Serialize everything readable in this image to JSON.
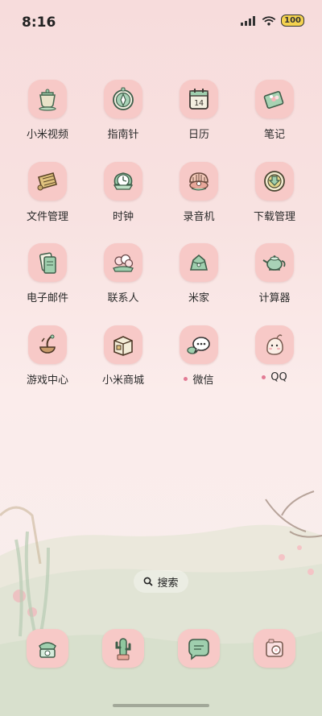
{
  "status": {
    "time": "8:16",
    "battery": "100"
  },
  "apps": [
    {
      "label": "小米视频",
      "icon": "tea-cup-icon"
    },
    {
      "label": "指南针",
      "icon": "compass-icon"
    },
    {
      "label": "日历",
      "icon": "calendar-icon",
      "day": "14"
    },
    {
      "label": "笔记",
      "icon": "notes-icon"
    },
    {
      "label": "文件管理",
      "icon": "scroll-icon"
    },
    {
      "label": "时钟",
      "icon": "clock-icon"
    },
    {
      "label": "录音机",
      "icon": "shell-icon"
    },
    {
      "label": "下载管理",
      "icon": "download-icon"
    },
    {
      "label": "电子邮件",
      "icon": "mail-icon"
    },
    {
      "label": "联系人",
      "icon": "contacts-icon"
    },
    {
      "label": "米家",
      "icon": "mijia-icon"
    },
    {
      "label": "计算器",
      "icon": "teapot-icon"
    },
    {
      "label": "游戏中心",
      "icon": "games-icon"
    },
    {
      "label": "小米商城",
      "icon": "box-icon"
    },
    {
      "label": "微信",
      "icon": "wechat-icon",
      "badge": true
    },
    {
      "label": "QQ",
      "icon": "qq-icon",
      "badge": true
    }
  ],
  "search": {
    "label": "搜索"
  },
  "dock": [
    {
      "icon": "phone-icon"
    },
    {
      "icon": "cactus-icon"
    },
    {
      "icon": "message-icon"
    },
    {
      "icon": "camera-icon"
    }
  ]
}
